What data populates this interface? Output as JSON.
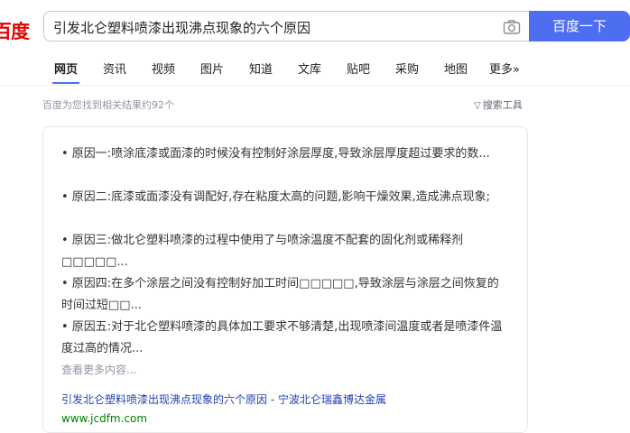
{
  "header": {
    "logo_text": "百度",
    "search_value": "引发北仑塑料喷漆出现沸点现象的六个原因",
    "search_button": "百度一下"
  },
  "tabs": [
    {
      "label": "网页",
      "active": true
    },
    {
      "label": "资讯"
    },
    {
      "label": "视频"
    },
    {
      "label": "图片"
    },
    {
      "label": "知道"
    },
    {
      "label": "文库"
    },
    {
      "label": "贴吧"
    },
    {
      "label": "采购"
    },
    {
      "label": "地图"
    },
    {
      "label": "更多»"
    }
  ],
  "results_meta": {
    "count_text": "百度为您找到相关结果约92个",
    "tools_label": "搜索工具"
  },
  "result": {
    "items": [
      "• 原因一:喷涂底漆或面漆的时候没有控制好涂层厚度,导致涂层厚度超过要求的数...",
      "• 原因二:底漆或面漆没有调配好,存在粘度太高的问题,影响干燥效果,造成沸点现象;",
      "• 原因三:做北仑塑料喷漆的过程中使用了与喷涂温度不配套的固化剂或稀释剂□□□□□...",
      "• 原因四:在多个涂层之间没有控制好加工时间□□□□□,导致涂层与涂层之间恢复的时间过短□□...",
      "• 原因五:对于北仑塑料喷漆的具体加工要求不够清楚,出现喷漆间温度或者是喷漆件温度过高的情况..."
    ],
    "more_text": "查看更多内容...",
    "title": "引发北仑塑料喷漆出现沸点现象的六个原因 - 宁波北仑瑞鑫博达金属",
    "url": "www.jcdfm.com"
  }
}
